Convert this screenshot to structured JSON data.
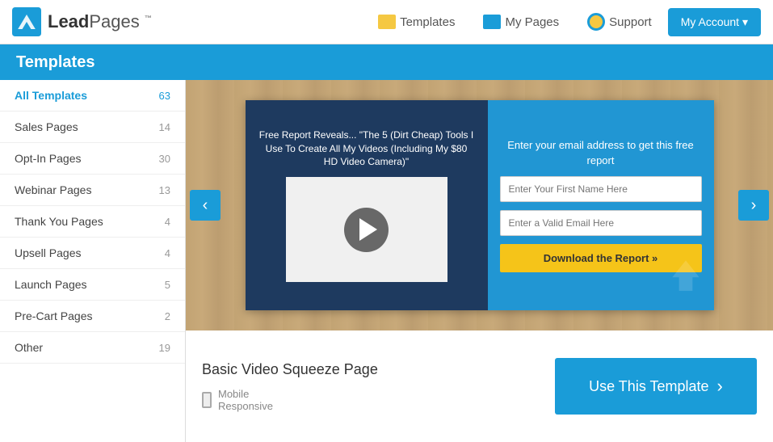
{
  "header": {
    "logo_text_bold": "Lead",
    "logo_text_normal": "Pages",
    "nav_items": [
      {
        "id": "templates",
        "label": "Templates",
        "icon": "templates-icon"
      },
      {
        "id": "my-pages",
        "label": "My Pages",
        "icon": "mypages-icon"
      },
      {
        "id": "support",
        "label": "Support",
        "icon": "support-icon"
      }
    ],
    "account_button": "My Account ▾"
  },
  "page_title": "Templates",
  "sidebar": {
    "items": [
      {
        "id": "all-templates",
        "label": "All Templates",
        "count": "63",
        "active": true
      },
      {
        "id": "sales-pages",
        "label": "Sales Pages",
        "count": "14"
      },
      {
        "id": "opt-in-pages",
        "label": "Opt-In Pages",
        "count": "30"
      },
      {
        "id": "webinar-pages",
        "label": "Webinar Pages",
        "count": "13"
      },
      {
        "id": "thank-you-pages",
        "label": "Thank You Pages",
        "count": "4"
      },
      {
        "id": "upsell-pages",
        "label": "Upsell Pages",
        "count": "4"
      },
      {
        "id": "launch-pages",
        "label": "Launch Pages",
        "count": "5"
      },
      {
        "id": "pre-cart-pages",
        "label": "Pre-Cart Pages",
        "count": "2"
      },
      {
        "id": "other",
        "label": "Other",
        "count": "19"
      }
    ]
  },
  "template": {
    "card": {
      "headline": "Free Report Reveals... \"The 5 (Dirt Cheap) Tools I Use To Create All My Videos (Including My $80 HD Video Camera)\"",
      "form_headline": "Enter your email address to get this free report",
      "input1_placeholder": "Enter Your First Name Here",
      "input2_placeholder": "Enter a Valid Email Here",
      "download_btn": "Download the Report »"
    },
    "info": {
      "name": "Basic Video Squeeze Page",
      "mobile_label": "Mobile",
      "responsive_label": "Responsive",
      "use_btn": "Use This Template"
    }
  },
  "nav_arrows": {
    "left": "‹",
    "right": "›"
  }
}
